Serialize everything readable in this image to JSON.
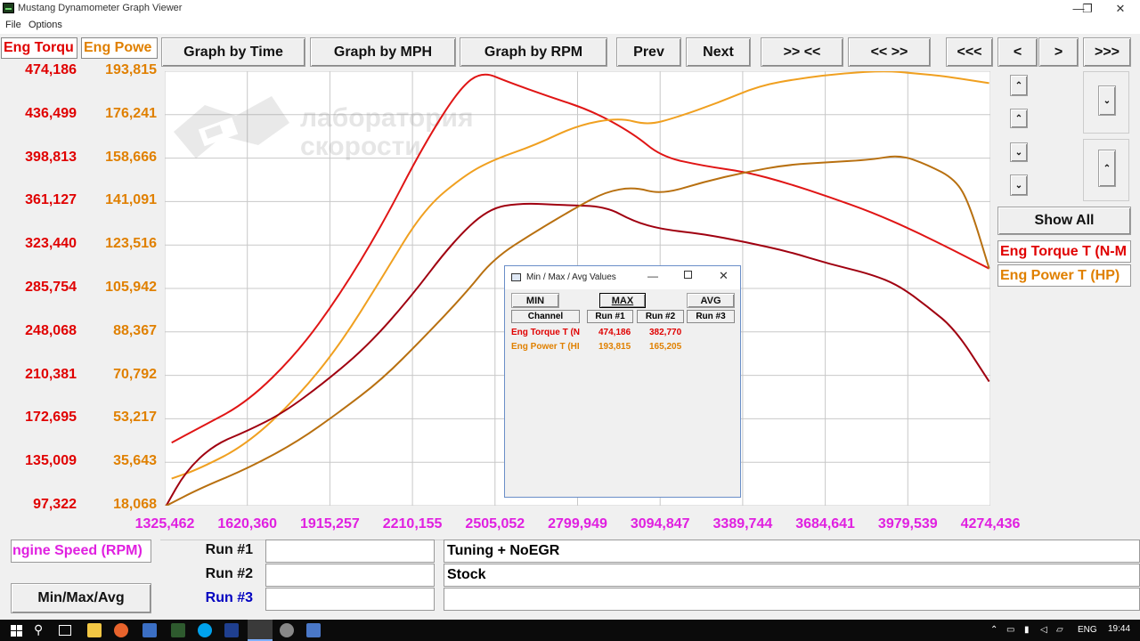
{
  "window": {
    "title": "Mustang Dynamometer Graph Viewer",
    "minimize": "—",
    "maximize": "❐",
    "close": "✕"
  },
  "menu": [
    "File",
    "Options"
  ],
  "toolbar": {
    "graph_by_time": "Graph by Time",
    "graph_by_mph": "Graph by MPH",
    "graph_by_rpm": "Graph by RPM",
    "prev": "Prev",
    "next": "Next",
    "zoom_in_x": ">> <<",
    "zoom_out_x": "<< >>",
    "first": "<<<",
    "back": "<",
    "forward": ">",
    "last": ">>>"
  },
  "axis_headers": {
    "left_primary": "Eng Torqu",
    "left_secondary": "Eng Powe"
  },
  "side_panel": {
    "show_all": "Show All",
    "channel_1": "Eng Torque T (N-M",
    "channel_2": "Eng Power T (HP)"
  },
  "bottom": {
    "x_channel": "ngine Speed (RPM)",
    "min_max_avg": "Min/Max/Avg",
    "runs": [
      {
        "label": "Run #1",
        "file": "",
        "description": "Tuning + NoEGR"
      },
      {
        "label": "Run #2",
        "file": "",
        "description": "Stock"
      },
      {
        "label": "Run #3",
        "file": "",
        "description": ""
      }
    ]
  },
  "watermark": {
    "line1": "лаборатория",
    "line2": "скорости"
  },
  "colors": {
    "torque_axis": "#e00000",
    "power_axis": "#e08000",
    "rpm_axis": "#e020e0",
    "run1_torque": "#e01515",
    "run1_power": "#f0a020",
    "run2_torque": "#a00010",
    "run2_power": "#b87010",
    "run3_label": "#0000c0"
  },
  "dialog": {
    "title": "Min / Max / Avg Values",
    "min": "MIN",
    "max": "MAX",
    "avg": "AVG",
    "col_channel": "Channel",
    "col_run1": "Run #1",
    "col_run2": "Run #2",
    "col_run3": "Run #3",
    "rows": [
      {
        "channel": "Eng Torque T (N",
        "run1": "474,186",
        "run2": "382,770"
      },
      {
        "channel": "Eng Power T (HI",
        "run1": "193,815",
        "run2": "165,205"
      }
    ]
  },
  "taskbar": {
    "lang": "ENG",
    "time": "19:44"
  },
  "chart_data": {
    "type": "line",
    "xlabel": "ngine Speed (RPM)",
    "xlim": [
      1325.462,
      4274.436
    ],
    "x_ticks": [
      "1325,462",
      "1620,360",
      "1915,257",
      "2210,155",
      "2505,052",
      "2799,949",
      "3094,847",
      "3389,744",
      "3684,641",
      "3979,539",
      "4274,436"
    ],
    "y_left_label": "Eng Torqu",
    "y_left_ticks": [
      "474,186",
      "436,499",
      "398,813",
      "361,127",
      "323,440",
      "285,754",
      "248,068",
      "210,381",
      "172,695",
      "135,009",
      "97,322"
    ],
    "ylim_left": [
      97.322,
      474.186
    ],
    "y_right_label": "Eng Powe",
    "y_right_ticks": [
      "193,815",
      "176,241",
      "158,666",
      "141,091",
      "123,516",
      "105,942",
      "88,367",
      "70,792",
      "53,217",
      "35,643",
      "18,068"
    ],
    "ylim_right": [
      18.068,
      193.815
    ],
    "grid": true,
    "series": [
      {
        "name": "Eng Torque T (N-M",
        "axis": "left",
        "run": "Run #1",
        "x": [
          1350,
          1450,
          1620,
          1800,
          1950,
          2100,
          2250,
          2380,
          2460,
          2550,
          2700,
          2850,
          3000,
          3100,
          3250,
          3400,
          3550,
          3700,
          3850,
          4000,
          4150,
          4270
        ],
        "y": [
          152,
          165,
          187,
          230,
          280,
          340,
          410,
          460,
          474,
          465,
          452,
          440,
          420,
          400,
          392,
          387,
          377,
          365,
          352,
          336,
          318,
          303
        ]
      },
      {
        "name": "Eng Power T (HP)",
        "axis": "right",
        "run": "Run #1",
        "x": [
          1350,
          1450,
          1620,
          1800,
          1950,
          2100,
          2250,
          2400,
          2500,
          2650,
          2800,
          2950,
          3050,
          3150,
          3300,
          3450,
          3600,
          3750,
          3900,
          4000,
          4100,
          4270
        ],
        "y": [
          29,
          33,
          43,
          62,
          83,
          110,
          138,
          152,
          158,
          164,
          172,
          175,
          172,
          175,
          181,
          188,
          191,
          193,
          194,
          193,
          192,
          189
        ]
      },
      {
        "name": "Eng Torque T (N-M",
        "axis": "left",
        "run": "Run #2",
        "x": [
          1330,
          1400,
          1500,
          1620,
          1750,
          1900,
          2050,
          2200,
          2350,
          2480,
          2600,
          2750,
          2900,
          3000,
          3100,
          3250,
          3400,
          3550,
          3700,
          3850,
          3950,
          4050,
          4150,
          4270
        ],
        "y": [
          97,
          127,
          150,
          162,
          178,
          205,
          236,
          277,
          325,
          355,
          360,
          358,
          357,
          344,
          337,
          333,
          326,
          318,
          307,
          298,
          288,
          270,
          250,
          205
        ]
      },
      {
        "name": "Eng Power T (HP)",
        "axis": "right",
        "run": "Run #2",
        "x": [
          1330,
          1450,
          1620,
          1800,
          1950,
          2100,
          2250,
          2400,
          2500,
          2650,
          2800,
          2900,
          3000,
          3100,
          3250,
          3400,
          3550,
          3700,
          3850,
          3950,
          4050,
          4150,
          4200,
          4270
        ],
        "y": [
          18,
          25,
          33,
          44,
          56,
          69,
          86,
          104,
          118,
          129,
          139,
          145,
          147,
          144,
          149,
          153,
          156,
          157,
          158,
          160,
          156,
          150,
          140,
          114
        ]
      }
    ]
  }
}
